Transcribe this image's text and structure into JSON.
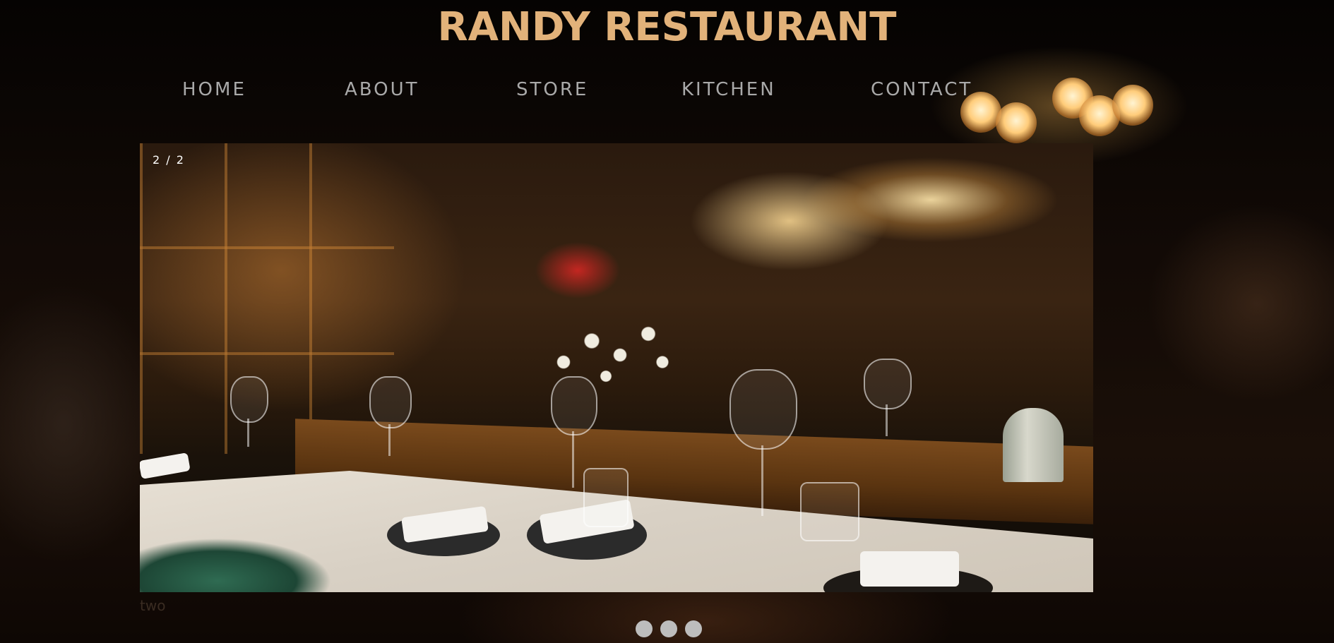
{
  "header": {
    "title": "RANDY RESTAURANT"
  },
  "nav": {
    "items": [
      {
        "label": "HOME"
      },
      {
        "label": "ABOUT"
      },
      {
        "label": "STORE"
      },
      {
        "label": "KITCHEN"
      },
      {
        "label": "CONTACT"
      }
    ]
  },
  "slideshow": {
    "counter": "2 / 2",
    "caption": "two",
    "dots": [
      {
        "state": "inactive"
      },
      {
        "state": "inactive"
      },
      {
        "state": "inactive"
      }
    ]
  },
  "colors": {
    "title": "#e2b27a",
    "nav_text": "#a9a9a9",
    "dot": "#bdbdbd",
    "background": "#0b0604"
  }
}
